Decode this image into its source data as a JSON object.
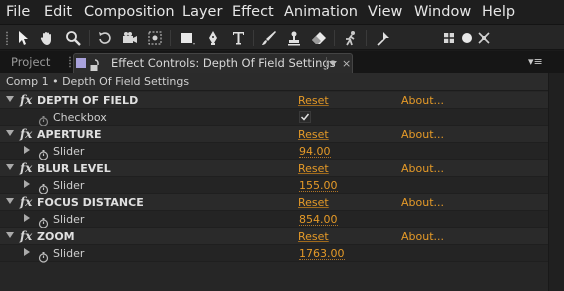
{
  "menubar": {
    "items": [
      "File",
      "Edit",
      "Composition",
      "Layer",
      "Effect",
      "Animation",
      "View",
      "Window",
      "Help"
    ]
  },
  "toolbar": {
    "tools": [
      "selection-tool-icon",
      "hand-tool-icon",
      "zoom-tool-icon",
      "rotation-tool-icon",
      "camera-tool-icon",
      "pan-behind-tool-icon",
      "rectangle-tool-icon",
      "pen-tool-icon",
      "type-tool-icon",
      "brush-tool-icon",
      "clone-stamp-tool-icon",
      "eraser-tool-icon",
      "roto-brush-tool-icon",
      "puppet-pin-tool-icon",
      "local-axis-icon",
      "world-axis-icon",
      "view-axis-icon"
    ]
  },
  "tabs": {
    "project": "Project",
    "active": "Effect Controls: Depth Of Field Settings",
    "close": "×",
    "panel_menu": "▾≡"
  },
  "panel": {
    "breadcrumb": "Comp 1 • Depth Of Field Settings",
    "fx_glyph": "fx",
    "effects": [
      {
        "name": "DEPTH OF FIELD",
        "reset": "Reset",
        "about": "About...",
        "property": "Checkbox",
        "control": "checkbox",
        "checked": true,
        "value": ""
      },
      {
        "name": "APERTURE",
        "reset": "Reset",
        "about": "About...",
        "property": "Slider",
        "control": "slider",
        "value": "94.00"
      },
      {
        "name": "BLUR LEVEL",
        "reset": "Reset",
        "about": "About...",
        "property": "Slider",
        "control": "slider",
        "value": "155.00"
      },
      {
        "name": "FOCUS DISTANCE",
        "reset": "Reset",
        "about": "About...",
        "property": "Slider",
        "control": "slider",
        "value": "854.00"
      },
      {
        "name": "ZOOM",
        "reset": "Reset",
        "about": "About...",
        "property": "Slider",
        "control": "slider",
        "value": "1763.00"
      }
    ]
  },
  "colors": {
    "accent_link": "#e59a28",
    "label_swatch": "#a9a2dc",
    "panel_bg": "#262626"
  }
}
